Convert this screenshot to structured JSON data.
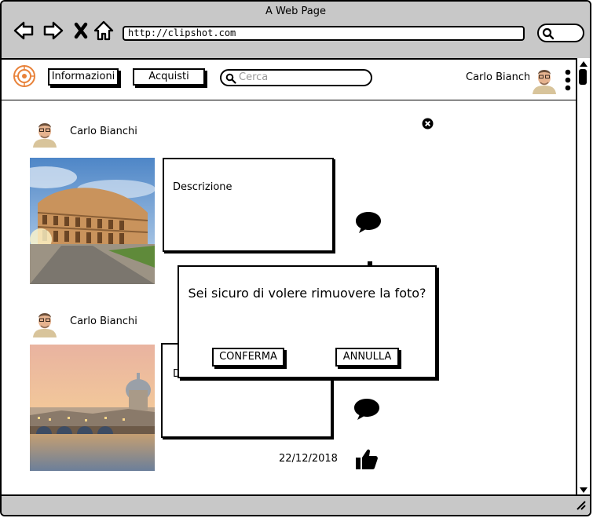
{
  "browser": {
    "window_title": "A Web Page",
    "url": "http://clipshot.com"
  },
  "header": {
    "nav_informazioni": "Informazioni",
    "nav_acquisti": "Acquisti",
    "search_placeholder": "Cerca",
    "user_name": "Carlo Bianchi"
  },
  "posts": [
    {
      "author": "Carlo Bianchi",
      "description": "Descrizione",
      "photo": "colosseum"
    },
    {
      "author": "Carlo Bianchi",
      "description": "D",
      "date": "22/12/2018",
      "photo": "rome-skyline"
    }
  ],
  "modal": {
    "message": "Sei sicuro di volere rimuovere la foto?",
    "confirm_label": "CONFERMA",
    "cancel_label": "ANNULLA"
  },
  "icons": {
    "logo": "target-logo-icon",
    "comment": "speech-bubble-icon",
    "like": "thumbs-up-icon",
    "close": "close-circle-icon",
    "menu": "vertical-dots-icon"
  },
  "colors": {
    "logo_orange": "#e8823a",
    "chrome_gray": "#c8c8c8"
  }
}
